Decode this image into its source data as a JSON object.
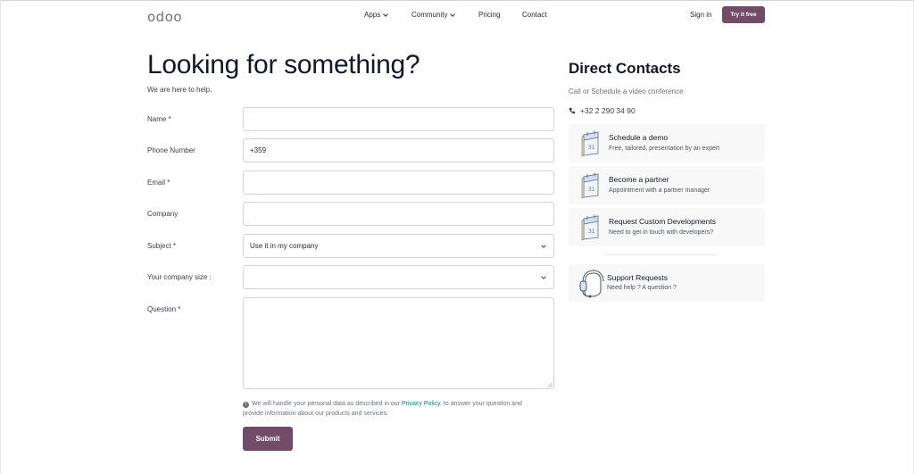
{
  "header": {
    "logo_text": "odoo",
    "nav": [
      "Apps",
      "Community",
      "Pricing",
      "Contact"
    ],
    "signin_label": "Sign in",
    "try_label": "Try it free"
  },
  "main": {
    "title": "Looking for something?",
    "subtitle": "We are here to help."
  },
  "form": {
    "name_label": "Name *",
    "phone_label": "Phone Number",
    "phone_value": "+359",
    "email_label": "Email *",
    "company_label": "Company",
    "subject_label": "Subject *",
    "subject_value": "Use it in my company",
    "size_label": "Your company size :",
    "size_value": "",
    "question_label": "Question *",
    "privacy_before": "We will handle your personal data as described in our ",
    "privacy_link": "Privacy Policy",
    "privacy_after": ", to answer your question and provide information about our products and services.",
    "submit_label": "Submit"
  },
  "contacts": {
    "title": "Direct Contacts",
    "subtitle": "Call or Schedule a video conference",
    "phone": "+32 2 290 34 90",
    "cards": [
      {
        "title": "Schedule a demo",
        "desc": "Free, tailored, presentation by an expert",
        "icon": "calendar-icon"
      },
      {
        "title": "Become a partner",
        "desc": "Appointment with a partner manager",
        "icon": "calendar-icon"
      },
      {
        "title": "Request Custom Developments",
        "desc": "Need to get in touch with developers?",
        "icon": "calendar-icon"
      }
    ],
    "support": {
      "title": "Support Requests",
      "desc": "Need help ? A question ?",
      "icon": "headset-icon"
    }
  },
  "colors": {
    "brand": "#714b67",
    "link": "#017e84"
  }
}
